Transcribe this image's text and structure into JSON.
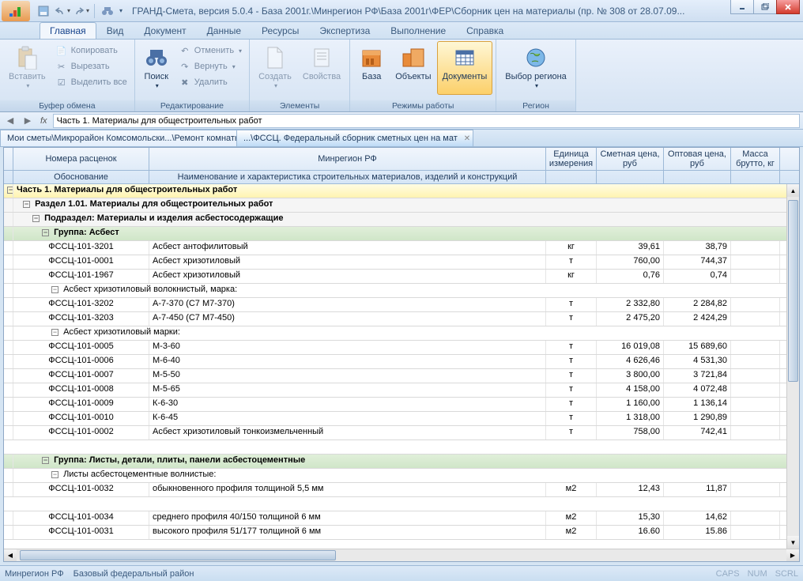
{
  "titlebar": {
    "title": "ГРАНД-Смета, версия 5.0.4 - База 2001г.\\Минрегион РФ\\База 2001г\\ФЕР\\Сборник цен на материалы (пр. № 308 от 28.07.09..."
  },
  "ribbon_tabs": [
    "Главная",
    "Вид",
    "Документ",
    "Данные",
    "Ресурсы",
    "Экспертиза",
    "Выполнение",
    "Справка"
  ],
  "ribbon": {
    "clipboard": {
      "title": "Буфер обмена",
      "paste": "Вставить",
      "copy": "Копировать",
      "cut": "Вырезать",
      "selectAll": "Выделить все"
    },
    "edit": {
      "title": "Редактирование",
      "search": "Поиск",
      "undo": "Отменить",
      "redo": "Вернуть",
      "delete": "Удалить"
    },
    "elements": {
      "title": "Элементы",
      "create": "Создать",
      "props": "Свойства"
    },
    "modes": {
      "title": "Режимы работы",
      "base": "База",
      "objects": "Объекты",
      "docs": "Документы"
    },
    "region": {
      "title": "Регион",
      "select": "Выбор региона"
    }
  },
  "formula_bar": {
    "value": "Часть 1. Материалы для общестроительных работ"
  },
  "doc_tabs": [
    {
      "label": "Мои сметы\\Микрорайон Комсомольски...\\Ремонт комнаты",
      "active": false
    },
    {
      "label": "...\\ФССЦ. Федеральный сборник сметных цен на мат",
      "active": true
    }
  ],
  "headers": {
    "code": "Номера расценок",
    "region": "Минрегион РФ",
    "unit": "Единица измерения",
    "price1": "Сметная цена, руб",
    "price2": "Оптовая цена, руб",
    "mass": "Масса брутто, кг",
    "basis": "Обоснование",
    "desc": "Наименование и характеристика строительных материалов, изделий и конструкций"
  },
  "sections": {
    "s1": "Часть 1. Материалы для общестроительных работ",
    "s2": "Раздел 1.01. Материалы для общестроительных работ",
    "s3": "Подраздел: Материалы и изделия асбестосодержащие",
    "g1": "Группа: Асбест",
    "sg1": "Асбест хризотиловый волокнистый, марка:",
    "sg2": "Асбест хризотиловый марки:",
    "g2": "Группа: Листы, детали, плиты, панели асбестоцементные",
    "sg3": "Листы асбестоцементные волнистые:"
  },
  "rows": [
    {
      "code": "ФССЦ-101-3201",
      "desc": "Асбест антофилитовый",
      "unit": "кг",
      "p1": "39,61",
      "p2": "38,79"
    },
    {
      "code": "ФССЦ-101-0001",
      "desc": "Асбест хризотиловый",
      "unit": "т",
      "p1": "760,00",
      "p2": "744,37"
    },
    {
      "code": "ФССЦ-101-1967",
      "desc": "Асбест хризотиловый",
      "unit": "кг",
      "p1": "0,76",
      "p2": "0,74"
    },
    {
      "code": "ФССЦ-101-3202",
      "desc": "А-7-370 (С7 М7-370)",
      "unit": "т",
      "p1": "2 332,80",
      "p2": "2 284,82"
    },
    {
      "code": "ФССЦ-101-3203",
      "desc": "А-7-450 (С7 М7-450)",
      "unit": "т",
      "p1": "2 475,20",
      "p2": "2 424,29"
    },
    {
      "code": "ФССЦ-101-0005",
      "desc": "М-3-60",
      "unit": "т",
      "p1": "16 019,08",
      "p2": "15 689,60"
    },
    {
      "code": "ФССЦ-101-0006",
      "desc": "М-6-40",
      "unit": "т",
      "p1": "4 626,46",
      "p2": "4 531,30"
    },
    {
      "code": "ФССЦ-101-0007",
      "desc": "М-5-50",
      "unit": "т",
      "p1": "3 800,00",
      "p2": "3 721,84"
    },
    {
      "code": "ФССЦ-101-0008",
      "desc": "М-5-65",
      "unit": "т",
      "p1": "4 158,00",
      "p2": "4 072,48"
    },
    {
      "code": "ФССЦ-101-0009",
      "desc": "К-6-30",
      "unit": "т",
      "p1": "1 160,00",
      "p2": "1 136,14"
    },
    {
      "code": "ФССЦ-101-0010",
      "desc": "К-6-45",
      "unit": "т",
      "p1": "1 318,00",
      "p2": "1 290,89"
    },
    {
      "code": "ФССЦ-101-0002",
      "desc": "Асбест хризотиловый тонкоизмельченный",
      "unit": "т",
      "p1": "758,00",
      "p2": "742,41"
    },
    {
      "code": "ФССЦ-101-0032",
      "desc": "обыкновенного профиля толщиной 5,5 мм",
      "unit": "м2",
      "p1": "12,43",
      "p2": "11,87"
    },
    {
      "code": "ФССЦ-101-0034",
      "desc": "среднего профиля 40/150 толщиной 6 мм",
      "unit": "м2",
      "p1": "15,30",
      "p2": "14,62"
    },
    {
      "code": "ФССЦ-101-0031",
      "desc": "высокого профиля 51/177 толщиной 6 мм",
      "unit": "м2",
      "p1": "16.60",
      "p2": "15.86"
    }
  ],
  "status": {
    "left1": "Минрегион РФ",
    "left2": "Базовый федеральный район",
    "caps": "CAPS",
    "num": "NUM",
    "scrl": "SCRL"
  }
}
